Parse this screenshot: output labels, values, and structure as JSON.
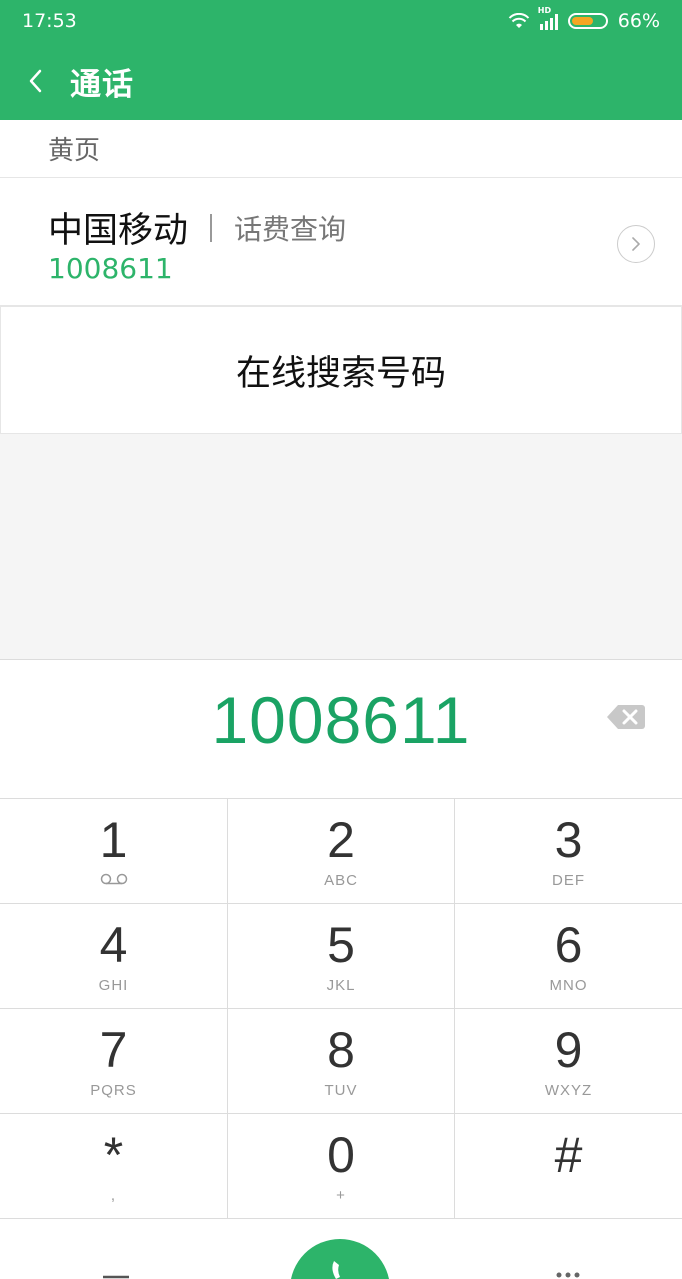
{
  "status_bar": {
    "time": "17:53",
    "network_label": "HD",
    "battery_percent": "66%",
    "battery_level": 0.66
  },
  "header": {
    "title": "通话"
  },
  "yellow_pages": {
    "section_title": "黄页",
    "entry": {
      "name": "中国移动",
      "service": "话费查询",
      "number": "1008611"
    }
  },
  "online_search": {
    "label": "在线搜索号码"
  },
  "dialer": {
    "number": "1008611"
  },
  "keypad": [
    {
      "digit": "1",
      "letters": ""
    },
    {
      "digit": "2",
      "letters": "ABC"
    },
    {
      "digit": "3",
      "letters": "DEF"
    },
    {
      "digit": "4",
      "letters": "GHI"
    },
    {
      "digit": "5",
      "letters": "JKL"
    },
    {
      "digit": "6",
      "letters": "MNO"
    },
    {
      "digit": "7",
      "letters": "PQRS"
    },
    {
      "digit": "8",
      "letters": "TUV"
    },
    {
      "digit": "9",
      "letters": "WXYZ"
    },
    {
      "digit": "*",
      "letters": ","
    },
    {
      "digit": "0",
      "letters": "+"
    },
    {
      "digit": "#",
      "letters": ""
    }
  ],
  "colors": {
    "brand_green": "#2db46a",
    "number_green": "#1aa364",
    "battery_orange": "#f5a623"
  }
}
